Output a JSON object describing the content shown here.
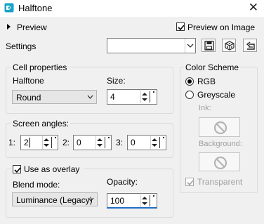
{
  "window": {
    "title": "Halftone",
    "close_glyph": "✕"
  },
  "preview_toggle": {
    "label": "Preview",
    "icon": "triangle-right-icon"
  },
  "preview_on_image": {
    "label": "Preview on Image",
    "checked": true
  },
  "settings": {
    "label": "Settings",
    "value": ""
  },
  "toolbar": {
    "icons": [
      "save-icon",
      "randomize-dice-icon",
      "reset-icon"
    ]
  },
  "cell_properties": {
    "title": "Cell properties",
    "halftone_label": "Halftone",
    "halftone_value": "Round",
    "size_label": "Size:",
    "size_value": "4"
  },
  "screen_angles": {
    "title": "Screen angles:",
    "channels": [
      {
        "label": "1:",
        "value": "2"
      },
      {
        "label": "2:",
        "value": "0"
      },
      {
        "label": "3:",
        "value": "0"
      }
    ]
  },
  "overlay": {
    "checkbox_label": "Use as overlay",
    "checked": true,
    "blend_label": "Blend mode:",
    "blend_value": "Luminance (Legacy)",
    "opacity_label": "Opacity:",
    "opacity_value": "100"
  },
  "color_scheme": {
    "title": "Color Scheme",
    "options": [
      {
        "label": "RGB",
        "selected": true
      },
      {
        "label": "Greyscale",
        "selected": false
      }
    ],
    "ink_label": "Ink:",
    "background_label": "Background:",
    "transparent_label": "Transparent",
    "transparent_checked": true
  },
  "colors": {
    "accent_blue": "#1f6fc5",
    "disabled_gray": "#a0a0a0",
    "panel_bg": "#f0f0f0"
  }
}
